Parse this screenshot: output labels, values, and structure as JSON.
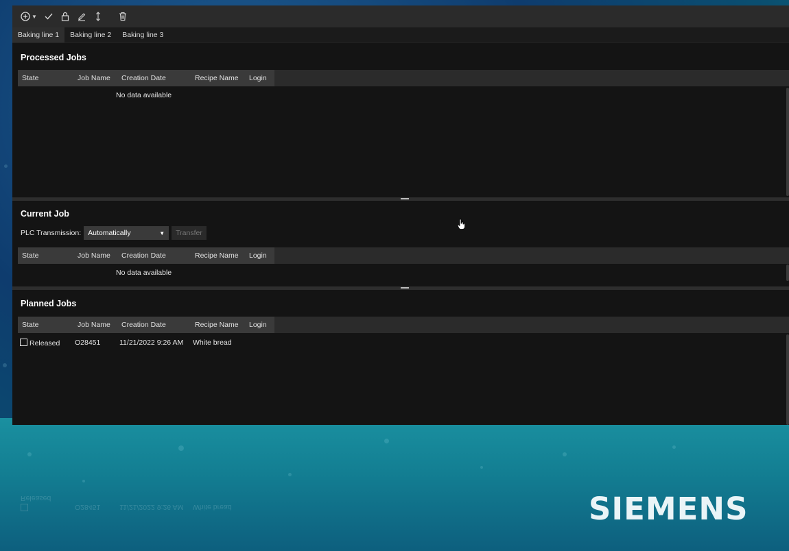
{
  "toolbar": {
    "icons": [
      "add-circle-icon",
      "dropdown-caret-icon",
      "check-icon",
      "lock-icon",
      "edit-icon",
      "sort-icon",
      "trash-icon"
    ]
  },
  "tabs": [
    {
      "label": "Baking line 1",
      "active": true
    },
    {
      "label": "Baking line 2",
      "active": false
    },
    {
      "label": "Baking line 3",
      "active": false
    }
  ],
  "columns": [
    "State",
    "Job Name",
    "Creation Date",
    "Recipe Name",
    "Login"
  ],
  "processed": {
    "title": "Processed Jobs",
    "empty_text": "No data available"
  },
  "current": {
    "title": "Current Job",
    "plc_label": "PLC Transmission:",
    "plc_value": "Automatically",
    "transfer_label": "Transfer",
    "empty_text": "No data available"
  },
  "planned": {
    "title": "Planned Jobs",
    "rows": [
      {
        "state": "Released",
        "job_name": "O28451",
        "creation_date": "11/21/2022 9:26 AM",
        "recipe_name": "White bread",
        "login": ""
      }
    ]
  },
  "brand": {
    "logo_text": "SIEMENS"
  },
  "colors": {
    "panel_bg": "#141414",
    "header_bg": "#2b2b2b",
    "accent": "#0b7f8a"
  }
}
